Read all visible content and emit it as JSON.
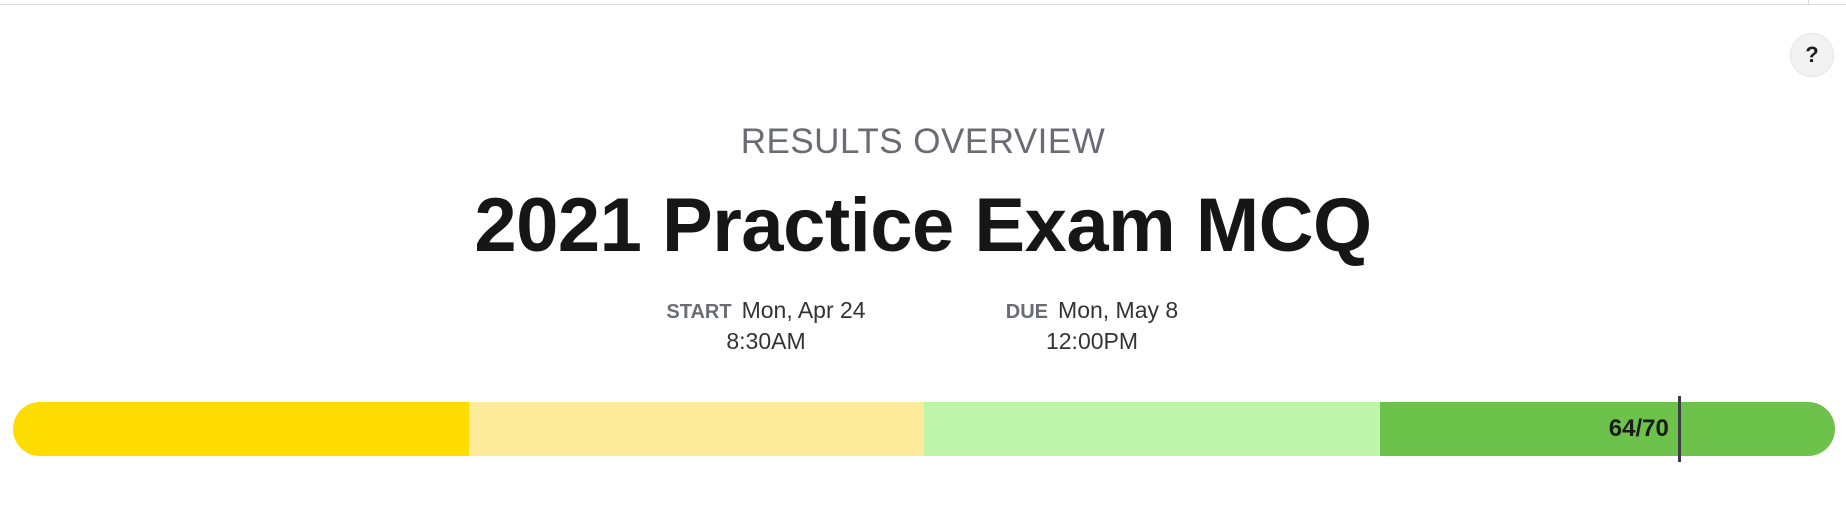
{
  "help": {
    "label": "?"
  },
  "header": {
    "overview_label": "RESULTS OVERVIEW",
    "title": "2021 Practice Exam MCQ"
  },
  "schedule": {
    "start": {
      "label": "START",
      "date": "Mon, Apr 24",
      "time": "8:30AM"
    },
    "due": {
      "label": "DUE",
      "date": "Mon, May 8",
      "time": "12:00PM"
    }
  },
  "score": {
    "label": "64/70",
    "earned": 64,
    "total": 70
  },
  "progress_segments": [
    {
      "color": "#ffdc00",
      "fraction": 0.25
    },
    {
      "color": "#ffeb9c",
      "fraction": 0.25
    },
    {
      "color": "#bff5aa",
      "fraction": 0.25
    },
    {
      "color": "#6cc24a",
      "fraction": 0.25
    }
  ]
}
